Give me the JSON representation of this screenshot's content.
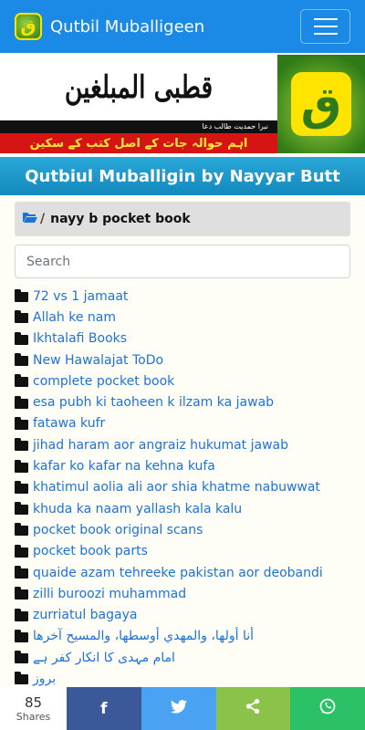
{
  "navbar": {
    "brand": "Qutbil Muballigeen",
    "logo_letter": "ق"
  },
  "banner": {
    "title": "قطبی المبلغین",
    "small_text": "نبرا حمدیت  طالب دعا",
    "subtitle": "اہم حوالہ جات کے اصل کتب کے سکین",
    "logo_letter": "ق"
  },
  "site_title": "Qutbiul Muballigin by Nayyar Butt",
  "breadcrumb": {
    "separator": "/",
    "current": "nayy b pocket book"
  },
  "search": {
    "placeholder": "Search",
    "value": ""
  },
  "folders": [
    "72 vs 1 jamaat",
    "Allah ke nam",
    "Ikhtalafi Books",
    "New Hawalajat ToDo",
    "complete pocket book",
    "esa pubh ki taoheen k ilzam ka jawab",
    "fatawa kufr",
    "jihad haram aor angraiz hukumat jawab",
    "kafar ko kafar na kehna kufa",
    "khatimul aolia ali aor shia khatme nabuwwat",
    "khuda ka naam yallash kala kalu",
    "pocket book original scans",
    "pocket book parts",
    "quaide azam tehreeke pakistan aor deobandi",
    "zilli buroozi muhammad",
    "zurriatul bagaya",
    "أنا أولها، والمهدي أوسطها، والمسيح آخرها",
    "امام مہدی کا انکار کفر ہے",
    "بروز"
  ],
  "share_bar": {
    "count": "85",
    "count_label": "Shares",
    "buttons": [
      {
        "name": "facebook",
        "glyph": "f",
        "color": "#3b5998"
      },
      {
        "name": "twitter",
        "glyph": "🐦",
        "color": "#4ba2f2"
      },
      {
        "name": "share",
        "glyph": "⟨",
        "color": "#8bc34a"
      },
      {
        "name": "whatsapp",
        "glyph": "✆",
        "color": "#2bc166"
      }
    ]
  }
}
